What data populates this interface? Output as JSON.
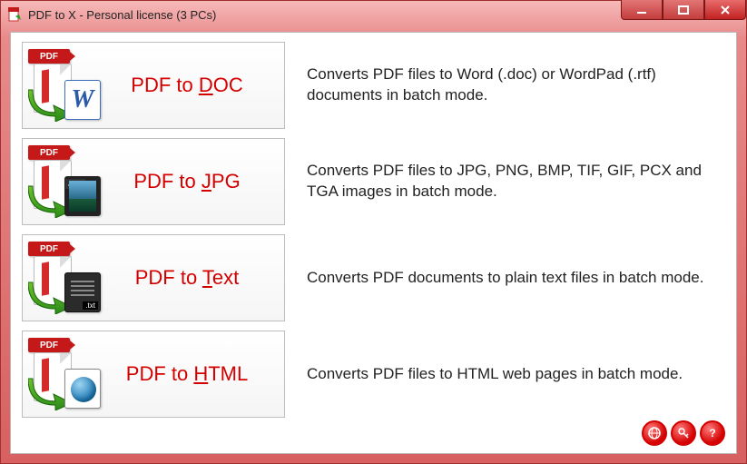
{
  "window": {
    "title": "PDF to X - Personal license (3 PCs)"
  },
  "modes": [
    {
      "label_prefix": "PDF to ",
      "label_ul": "D",
      "label_suffix": "OC",
      "desc": "Converts PDF files to Word (.doc) or WordPad (.rtf) documents in batch mode."
    },
    {
      "label_prefix": "PDF to ",
      "label_ul": "J",
      "label_suffix": "PG",
      "desc": "Converts PDF files to JPG, PNG, BMP, TIF, GIF, PCX and TGA images in batch mode."
    },
    {
      "label_prefix": "PDF to ",
      "label_ul": "T",
      "label_suffix": "ext",
      "desc": "Converts PDF documents to plain text files in batch mode."
    },
    {
      "label_prefix": "PDF to ",
      "label_ul": "H",
      "label_suffix": "TML",
      "desc": "Converts PDF files to HTML web pages in batch mode."
    }
  ],
  "pdf_badge_text": "PDF",
  "jpg_tag": "JPG",
  "txt_tag": ".txt",
  "footer": {
    "website_icon": "globe-icon",
    "register_icon": "key-icon",
    "help_icon": "question-icon"
  }
}
